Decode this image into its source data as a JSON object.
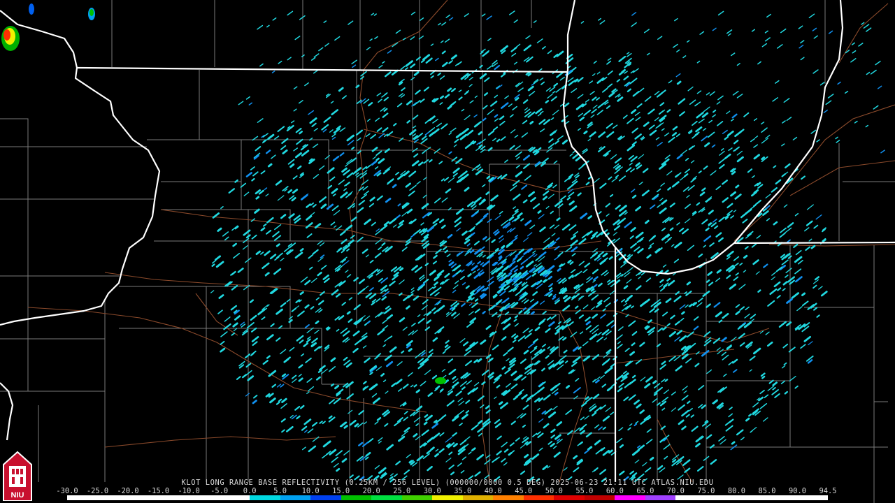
{
  "caption": "KLOT LONG RANGE BASE REFLECTIVITY (0.25KM / 256 LEVEL) (000000/0000 0.5 DEG) 2025-06-23 21:11 UTC  ATLAS.NIU.EDU",
  "scale": {
    "labels": [
      "-30.0",
      "-25.0",
      "-20.0",
      "-15.0",
      "-10.0",
      "-5.0",
      "0.0",
      "5.0",
      "10.0",
      "15.0",
      "20.0",
      "25.0",
      "30.0",
      "35.0",
      "40.0",
      "45.0",
      "50.0",
      "55.0",
      "60.0",
      "65.0",
      "70.0",
      "75.0",
      "80.0",
      "85.0",
      "90.0",
      "94.5"
    ],
    "colors": [
      "#ffffff",
      "#ffffff",
      "#ffffff",
      "#ffffff",
      "#ffffff",
      "#ffffff",
      "#00d8e0",
      "#00a0f0",
      "#0040f0",
      "#00c000",
      "#00e040",
      "#40d000",
      "#f0f000",
      "#e0b000",
      "#ff8000",
      "#ff3000",
      "#e00000",
      "#c00000",
      "#ff00ff",
      "#a040ff",
      "#ffffff",
      "#ffffff",
      "#ffffff",
      "#ffffff",
      "#ffffff"
    ]
  },
  "logo": {
    "text": "NIU",
    "colors": {
      "red": "#c8102e",
      "white": "#ffffff"
    }
  },
  "map_colors": {
    "state_border": "#ffffff",
    "county_line": "#7a7a7a",
    "highway": "#8b4a2b",
    "echo_light": "#20d8e0",
    "echo_mid": "#1090f0"
  }
}
